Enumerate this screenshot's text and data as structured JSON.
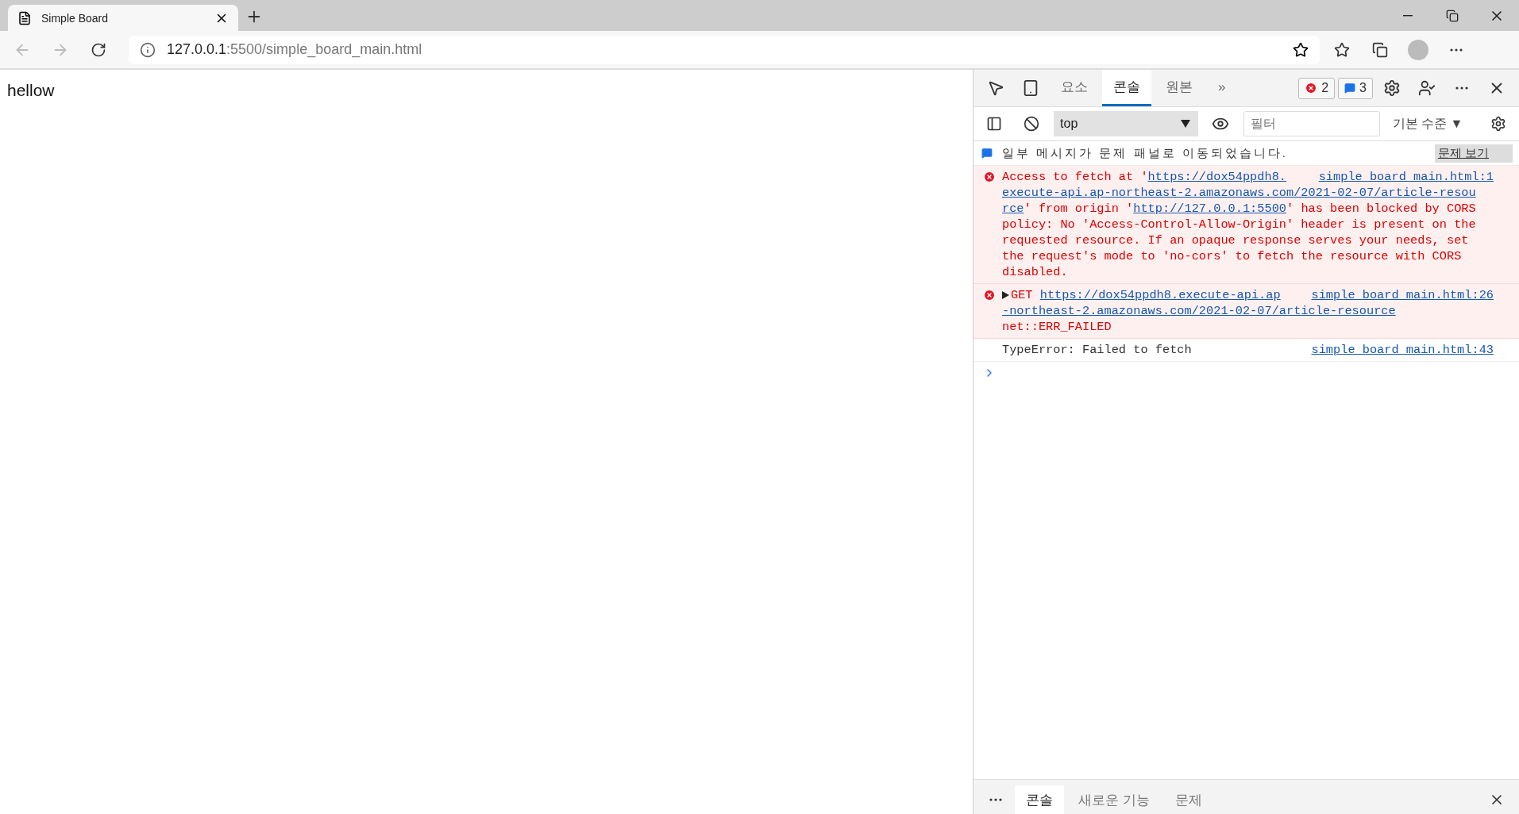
{
  "browser": {
    "tab": {
      "title": "Simple Board"
    },
    "address": {
      "host": "127.0.0.1",
      "rest": ":5500/simple_board_main.html"
    }
  },
  "page": {
    "text": "hellow"
  },
  "devtools": {
    "tabs": [
      {
        "label": "요소",
        "selected": false
      },
      {
        "label": "콘솔",
        "selected": true
      },
      {
        "label": "원본",
        "selected": false
      }
    ],
    "more_tabs": "»",
    "error_count": "2",
    "info_count": "3",
    "context": "top",
    "filter": {
      "placeholder": "필터"
    },
    "level_menu": "기본 수준 ▼",
    "notice": {
      "text": "일부 메시지가 문제 패널로 이동되었습니다.",
      "button": "문제 보기"
    },
    "messages": [
      {
        "kind": "error",
        "expander": false,
        "source": "simple_board_main.html:1",
        "lines": [
          [
            {
              "text": "Access to fetch at '",
              "link": false
            },
            {
              "text": "https://dox54ppdh8.",
              "link": true
            }
          ],
          [
            {
              "text": "execute-api.ap-northeast-2.amazonaws.com/2021-02-07/article-resou",
              "link": true
            }
          ],
          [
            {
              "text": "rce",
              "link": true
            },
            {
              "text": "' from origin '",
              "link": false
            },
            {
              "text": "http://127.0.0.1:5500",
              "link": true
            },
            {
              "text": "' has been blocked by CORS",
              "link": false
            }
          ],
          [
            {
              "text": "policy: No 'Access-Control-Allow-Origin' header is present on the",
              "link": false
            }
          ],
          [
            {
              "text": "requested resource. If an opaque response serves your needs, set",
              "link": false
            }
          ],
          [
            {
              "text": "the request's mode to 'no-cors' to fetch the resource with CORS",
              "link": false
            }
          ],
          [
            {
              "text": "disabled.",
              "link": false
            }
          ]
        ]
      },
      {
        "kind": "error",
        "expander": true,
        "source": "simple_board_main.html:26",
        "lines": [
          [
            {
              "text": "GET ",
              "link": false
            },
            {
              "text": "https://dox54ppdh8.execute-api.ap",
              "link": true
            }
          ],
          [
            {
              "text": "-northeast-2.amazonaws.com/2021-02-07/article-resource",
              "link": true
            }
          ],
          [
            {
              "text": "net::ERR_FAILED",
              "link": false
            }
          ]
        ]
      },
      {
        "kind": "log",
        "expander": false,
        "source": "simple_board_main.html:43",
        "lines": [
          [
            {
              "text": "TypeError: Failed to fetch",
              "link": false
            }
          ]
        ]
      }
    ],
    "drawer": {
      "tabs": [
        {
          "label": "콘솔",
          "selected": true
        },
        {
          "label": "새로운 기능",
          "selected": false
        },
        {
          "label": "문제",
          "selected": false
        }
      ]
    }
  }
}
